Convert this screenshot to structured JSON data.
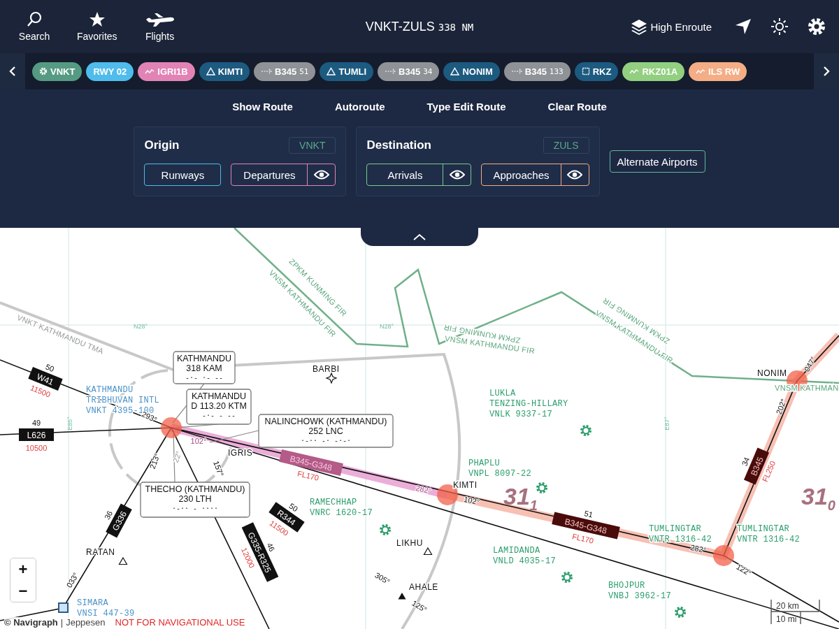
{
  "toolbar": [
    {
      "label": "Search",
      "kind": "search"
    },
    {
      "label": "Favorites",
      "kind": "star"
    },
    {
      "label": "Flights",
      "kind": "plane"
    }
  ],
  "title": {
    "route": "VNKT-ZULS",
    "distance": "338",
    "unit": "NM"
  },
  "layer": {
    "label": "High Enroute"
  },
  "route_chips": [
    {
      "label": "VNKT",
      "kind": "airport",
      "color": "#559a82"
    },
    {
      "label": "RWY 02",
      "kind": "runway",
      "color": "#4fbcec"
    },
    {
      "label": "IGRI1B",
      "kind": "procedure",
      "color": "#e283b6"
    },
    {
      "label": "KIMTI",
      "kind": "waypoint",
      "color": "#1d5a80"
    },
    {
      "label": "B345",
      "sub": "51",
      "kind": "airway",
      "color": "#8f9296"
    },
    {
      "label": "TUMLI",
      "kind": "waypoint",
      "color": "#1d5a80"
    },
    {
      "label": "B345",
      "sub": "34",
      "kind": "airway",
      "color": "#8f9296"
    },
    {
      "label": "NONIM",
      "kind": "waypoint",
      "color": "#1d5a80"
    },
    {
      "label": "B345",
      "sub": "133",
      "kind": "airway",
      "color": "#8f9296"
    },
    {
      "label": "RKZ",
      "kind": "vor",
      "color": "#1d5a80"
    },
    {
      "label": "RKZ01A",
      "kind": "procedure",
      "color": "#92cf80"
    },
    {
      "label": "ILS RW",
      "kind": "procedure",
      "color": "#f4ad85"
    }
  ],
  "actions": [
    "Show Route",
    "Autoroute",
    "Type Edit Route",
    "Clear Route"
  ],
  "origin": {
    "title": "Origin",
    "code": "VNKT",
    "buttons": [
      {
        "label": "Runways",
        "color": "#4fbcec",
        "eye": false
      },
      {
        "label": "Departures",
        "color": "#e283b6",
        "eye": true
      }
    ]
  },
  "destination": {
    "title": "Destination",
    "code": "ZULS",
    "buttons": [
      {
        "label": "Arrivals",
        "color": "#7cc98f",
        "eye": true
      },
      {
        "label": "Approaches",
        "color": "#f4ad85",
        "eye": true
      }
    ]
  },
  "alternate": "Alternate Airports",
  "map": {
    "grid_labels": [
      "N28°",
      "N28°",
      "E85°",
      "E87°"
    ],
    "boundary_labels": [
      "VNKT KATHMANDU TMA",
      "ZPKM KUNMING FIR",
      "VNSM KATHMANDU FIR",
      "ZPKM KUNMING FIR",
      "VNSM KATHMANDU FIR",
      "ZPKM KUNMING FIR",
      "VNSM KATHMANDU FIR",
      "VNSM KATHMAN"
    ],
    "navaids": [
      {
        "name": "KATHMANDU",
        "ident": "318 KAM",
        "morse": "-·-  ·-  --"
      },
      {
        "name": "KATHMANDU",
        "ident": "D 113.20 KTM",
        "morse": "-·-  -  --"
      },
      {
        "name": "NALINCHOWK (KATHMANDU)",
        "ident": "252 LNC",
        "morse": "·-··  -·  -·-·"
      },
      {
        "name": "THECHO (KATHMANDU)",
        "ident": "230 LTH",
        "morse": "·-··  -  ····"
      }
    ],
    "waypoints": [
      {
        "name": "BARBI",
        "kind": "star"
      },
      {
        "name": "IGRIS",
        "kind": "none"
      },
      {
        "name": "KIMTI",
        "kind": "none"
      },
      {
        "name": "LIKHU",
        "kind": "triangle"
      },
      {
        "name": "AHALE",
        "kind": "filled"
      },
      {
        "name": "RATAN",
        "kind": "triangle"
      },
      {
        "name": "NONIM",
        "kind": "none"
      }
    ],
    "airports": [
      {
        "lines": [
          "KATHMANDU",
          "TRIBHUVAN INTL",
          "VNKT 4395-100"
        ],
        "kind": "major"
      },
      {
        "lines": [
          "LUKLA",
          "TENZING-HILLARY",
          "VNLK 9337-17"
        ],
        "kind": "minor"
      },
      {
        "lines": [
          "PHAPLU",
          "VNPL 8097-22"
        ],
        "kind": "minor"
      },
      {
        "lines": [
          "RAMECHHAP",
          "VNRC 1620-17"
        ],
        "kind": "minor"
      },
      {
        "lines": [
          "LAMIDANDA",
          "VNLD 4035-17"
        ],
        "kind": "minor"
      },
      {
        "lines": [
          "TUMLINGTAR",
          "VNTR 1316-42"
        ],
        "kind": "minor"
      },
      {
        "lines": [
          "TUMLINGTAR",
          "VNTR 1316-42"
        ],
        "kind": "minor"
      },
      {
        "lines": [
          "BHOJPUR",
          "VNBJ 3962-17"
        ],
        "kind": "minor"
      },
      {
        "lines": [
          "SIMARA",
          "VNSI 447-39"
        ],
        "kind": "major"
      }
    ],
    "airways": [
      {
        "name": "W41",
        "distance": "50",
        "altitude": "11500",
        "kind": "plain"
      },
      {
        "name": "L626",
        "distance": "49",
        "altitude": "10500",
        "kind": "plain"
      },
      {
        "name": "G336",
        "distance": "36",
        "kind": "plain"
      },
      {
        "name": "G335-R325",
        "distance": "46",
        "altitude": "12000",
        "kind": "plain"
      },
      {
        "name": "R344",
        "distance": "50",
        "altitude": "11500",
        "kind": "plain"
      },
      {
        "name": "B345-G348",
        "altitude": "FL170",
        "kind": "departure"
      },
      {
        "name": "B345-G348",
        "distance": "51",
        "altitude": "FL170",
        "kind": "route"
      },
      {
        "name": "B345",
        "distance": "34",
        "altitude": "FL250",
        "kind": "route"
      }
    ],
    "courses": [
      "293°",
      "102°",
      "213°",
      "22°",
      "157°",
      "282°",
      "102°",
      "282°",
      "122°",
      "202°",
      "047°",
      "033°",
      "305°",
      "125°"
    ],
    "mora": [
      {
        "value": "31",
        "sub": "1"
      },
      {
        "value": "31",
        "sub": "0"
      }
    ],
    "scale": {
      "km": "20 km",
      "mi": "10 mi"
    }
  },
  "zoom": {
    "in": "+",
    "out": "−"
  },
  "footer": {
    "copyright": "© Navigraph",
    "separator": "|",
    "provider": "Jeppesen",
    "warning": "NOT FOR NAVIGATIONAL USE"
  }
}
